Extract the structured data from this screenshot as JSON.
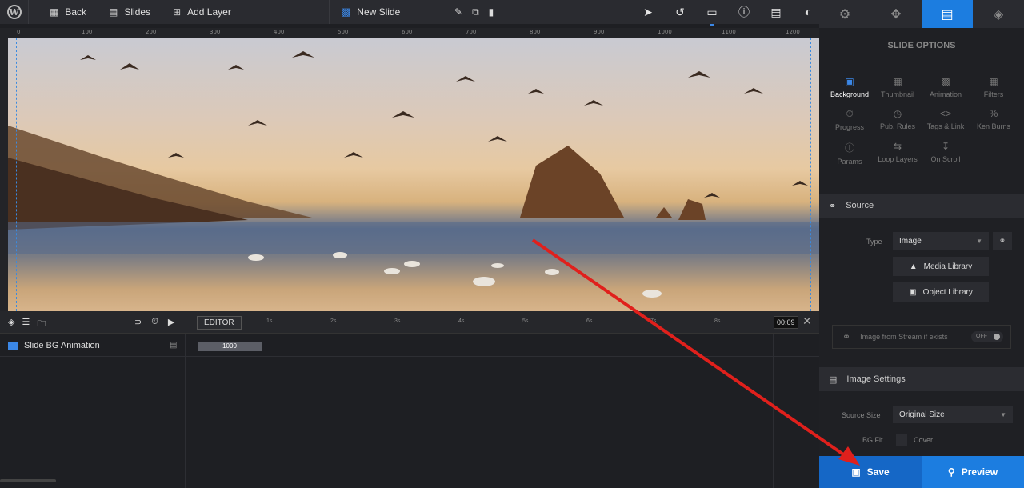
{
  "toolbar": {
    "back": "Back",
    "slides": "Slides",
    "add_layer": "Add Layer",
    "new_slide": "New Slide"
  },
  "ruler": {
    "top_ticks": [
      "0",
      "100",
      "200",
      "300",
      "400",
      "500",
      "600",
      "700",
      "800",
      "900",
      "1000",
      "1100",
      "1200"
    ]
  },
  "timeline": {
    "editor_label": "EDITOR",
    "ticks": [
      "1s",
      "2s",
      "3s",
      "4s",
      "5s",
      "6s",
      "7s",
      "8s"
    ],
    "time": "00:09",
    "row_label": "Slide BG Animation",
    "duration": "1000"
  },
  "panel": {
    "title": "SLIDE OPTIONS",
    "options": [
      {
        "label": "Background",
        "icon": "image-icon",
        "active": true
      },
      {
        "label": "Thumbnail",
        "icon": "thumbnail-icon",
        "active": false
      },
      {
        "label": "Animation",
        "icon": "film-icon",
        "active": false
      },
      {
        "label": "Filters",
        "icon": "grid-icon",
        "active": false
      },
      {
        "label": "Progress",
        "icon": "timer-icon",
        "active": false
      },
      {
        "label": "Pub. Rules",
        "icon": "clock-icon",
        "active": false
      },
      {
        "label": "Tags & Link",
        "icon": "code-icon",
        "active": false
      },
      {
        "label": "Ken Burns",
        "icon": "percent-icon",
        "active": false
      },
      {
        "label": "Params",
        "icon": "info-icon",
        "active": false
      },
      {
        "label": "Loop Layers",
        "icon": "loop-icon",
        "active": false
      },
      {
        "label": "On Scroll",
        "icon": "scroll-icon",
        "active": false
      }
    ],
    "source_section": "Source",
    "type_label": "Type",
    "type_value": "Image",
    "media_library": "Media Library",
    "object_library": "Object Library",
    "stream_label": "Image from Stream if exists",
    "stream_toggle": "OFF",
    "image_settings_section": "Image Settings",
    "source_size_label": "Source Size",
    "source_size_value": "Original Size",
    "bg_fit_label": "BG Fit",
    "bg_fit_cover": "Cover"
  },
  "footer": {
    "save": "Save",
    "preview": "Preview"
  },
  "colors": {
    "accent": "#1c7de0",
    "annotation_arrow": "#e0201c"
  }
}
